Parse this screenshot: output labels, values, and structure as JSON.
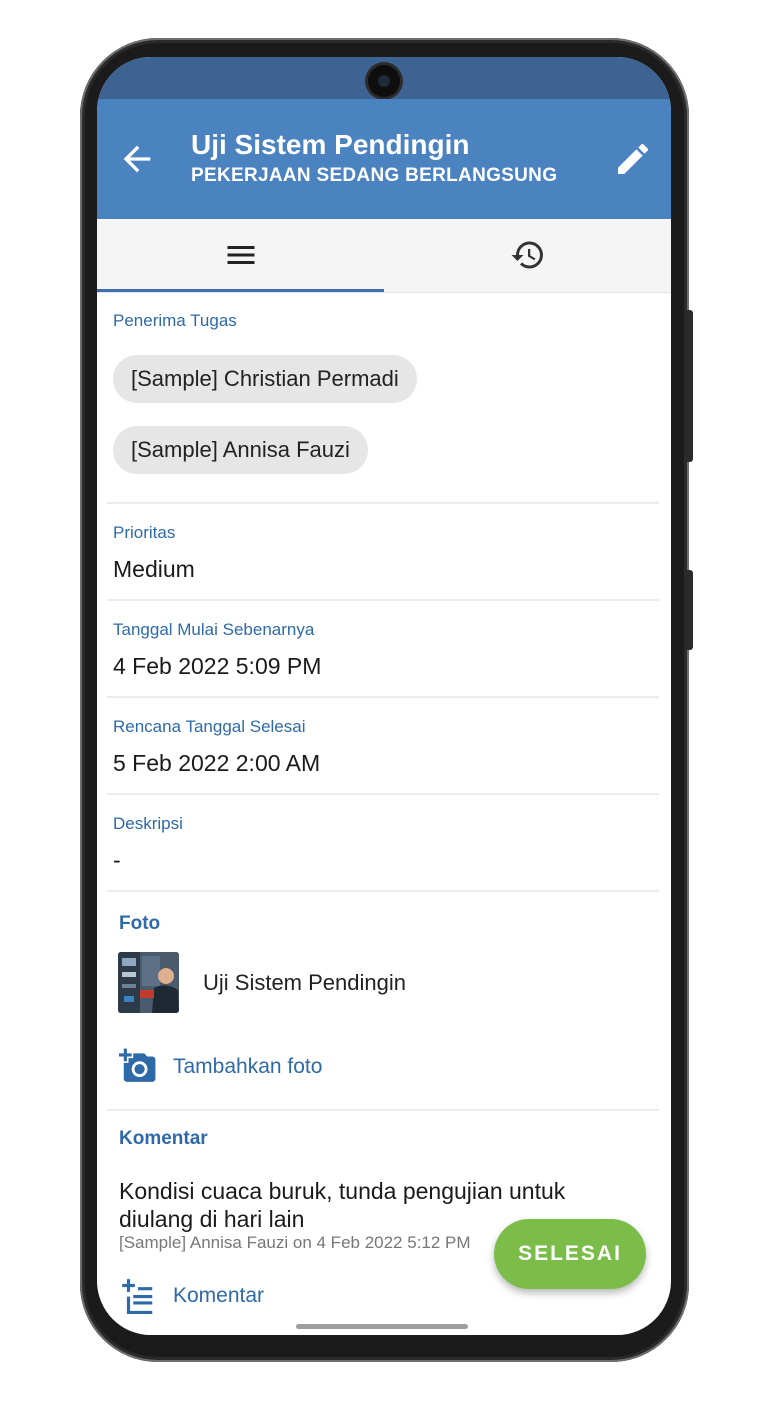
{
  "appbar": {
    "title": "Uji Sistem Pendingin",
    "subtitle": "PEKERJAAN SEDANG BERLANGSUNG",
    "back_icon": "arrow-back-icon",
    "edit_icon": "pencil-edit-icon"
  },
  "tabs": [
    {
      "icon": "menu-lines-icon",
      "selected": true
    },
    {
      "icon": "history-clock-icon",
      "selected": false
    }
  ],
  "assignees": {
    "label": "Penerima Tugas",
    "people": [
      "[Sample] Christian Permadi",
      "[Sample] Annisa Fauzi"
    ]
  },
  "priority": {
    "label": "Prioritas",
    "value": "Medium"
  },
  "actual_start": {
    "label": "Tanggal Mulai Sebenarnya",
    "value": "4 Feb 2022 5:09 PM"
  },
  "planned_end": {
    "label": "Rencana Tanggal Selesai",
    "value": "5 Feb 2022 2:00 AM"
  },
  "description": {
    "label": "Deskripsi",
    "value": "-"
  },
  "photos": {
    "title": "Foto",
    "items": [
      {
        "name": "Uji Sistem Pendingin"
      }
    ],
    "add_label": "Tambahkan foto",
    "add_icon": "add-photo-camera-icon"
  },
  "comments": {
    "title": "Komentar",
    "items": [
      {
        "text": "Kondisi cuaca buruk, tunda pengujian untuk diulang di hari lain",
        "meta": "[Sample] Annisa Fauzi on 4 Feb 2022 5:12 PM"
      }
    ],
    "add_label": "Komentar",
    "add_icon": "add-comment-list-icon"
  },
  "fab": {
    "label": "SELESAI"
  },
  "colors": {
    "appbar": "#4b82c0",
    "statusbar": "#3d6392",
    "accent_text": "#2f6aa8",
    "fab": "#7cbd4a",
    "chip": "#e6e6e6"
  }
}
